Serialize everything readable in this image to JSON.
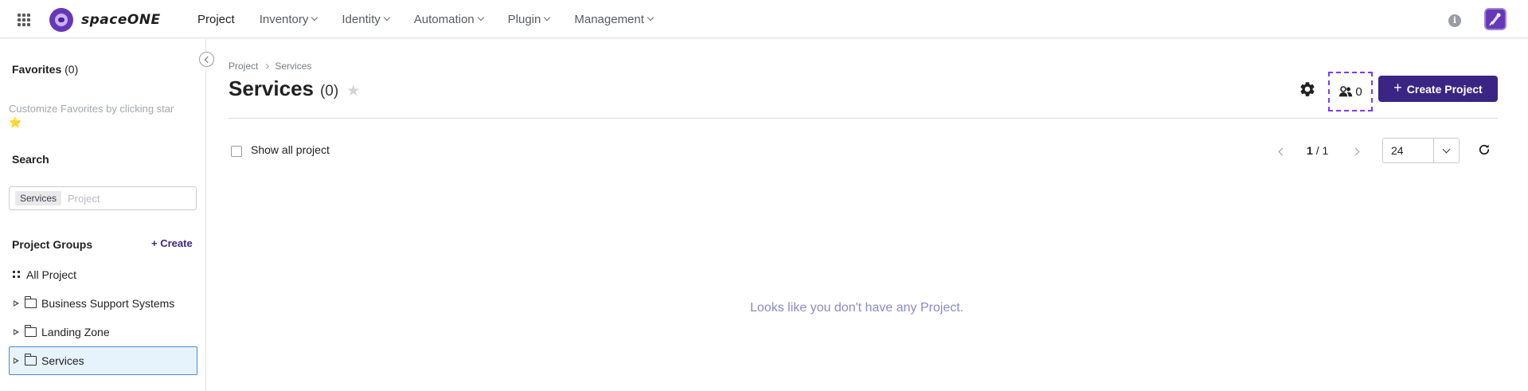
{
  "topnav": {
    "logo_text": "spaceONE",
    "menu": [
      {
        "label": "Project",
        "has_caret": false,
        "active": true
      },
      {
        "label": "Inventory",
        "has_caret": true
      },
      {
        "label": "Identity",
        "has_caret": true
      },
      {
        "label": "Automation",
        "has_caret": true
      },
      {
        "label": "Plugin",
        "has_caret": true
      },
      {
        "label": "Management",
        "has_caret": true
      }
    ],
    "info_glyph": "i"
  },
  "sidebar": {
    "favorites_title": "Favorites",
    "favorites_count": "(0)",
    "favorites_help": "Customize Favorites by clicking star",
    "favorites_help_star": "⭐",
    "search_title": "Search",
    "search_tag": "Services",
    "search_placeholder": "Project",
    "groups_title": "Project Groups",
    "groups_create_label": "+ Create",
    "tree": [
      {
        "label": "All Project",
        "icon": "dots-icon"
      },
      {
        "label": "Business Support Systems",
        "icon": "folder-icon"
      },
      {
        "label": "Landing Zone",
        "icon": "folder-icon"
      },
      {
        "label": "Services",
        "icon": "folder-icon",
        "selected": true
      }
    ]
  },
  "main": {
    "breadcrumb": [
      "Project",
      "Services"
    ],
    "title": "Services",
    "title_count": "(0)",
    "member_count": "0",
    "create_button_label": "Create Project",
    "show_all_label": "Show all project",
    "page_current": "1",
    "page_total": "/ 1",
    "page_size": "24",
    "empty_message": "Looks like you don't have any Project."
  },
  "colors": {
    "primary": "#3b2584",
    "brand": "#6638b6",
    "selected_bg": "#e6f2fc",
    "selected_border": "#4a8bd1",
    "empty_text": "#8a8cc4",
    "focus_outline": "#7a3cf5"
  }
}
